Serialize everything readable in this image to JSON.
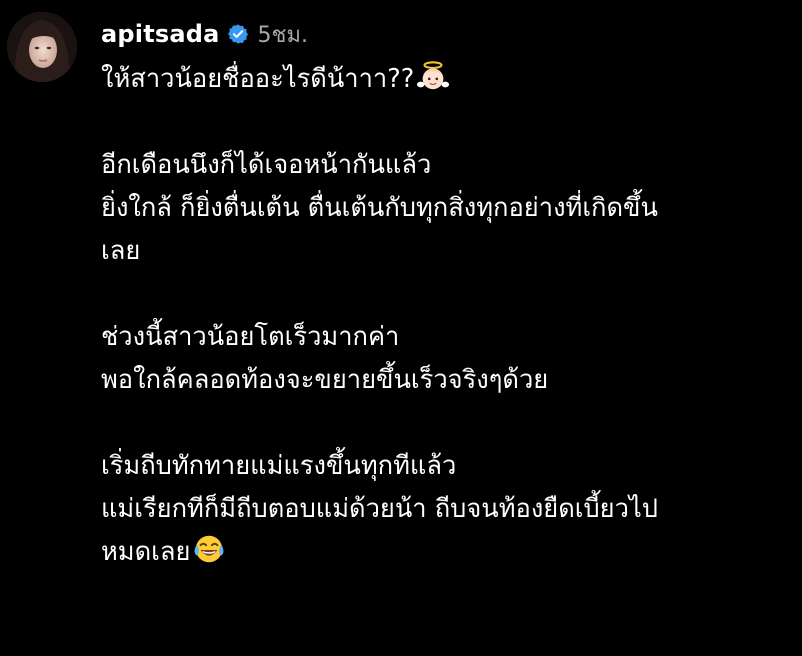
{
  "post": {
    "username": "apitsada",
    "timestamp": "5ชม.",
    "verified": true,
    "accent_color": "#3897f0",
    "caption": {
      "line1": "ให้สาวน้อยชื่ออะไรดีน้าาา??",
      "line1_emoji": "baby-angel-emoji",
      "line2": "อีกเดือนนึงก็ได้เจอหน้ากันแล้ว",
      "line3": "ยิ่งใกล้ ก็ยิ่งตื่นเต้น ตื่นเต้นกับทุกสิ่งทุกอย่างที่เกิดขึ้น",
      "line4": "เลย",
      "line5": "ช่วงนี้สาวน้อยโตเร็วมากค่า",
      "line6": "พอใกล้คลอดท้องจะขยายขึ้นเร็วจริงๆด้วย",
      "line7": "เริ่มถีบทักทายแม่แรงขึ้นทุกทีแล้ว",
      "line8": "แม่เรียกทีก็มีถีบตอบแม่ด้วยน้า ถีบจนท้องยืดเบี้ยวไป",
      "line9": "หมดเลย",
      "line9_emoji": "tears-of-joy-emoji"
    }
  }
}
